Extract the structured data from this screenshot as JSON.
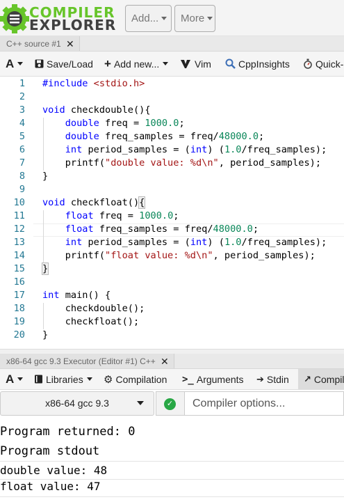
{
  "app": {
    "logo_top": "COMPILER",
    "logo_bottom": "EXPLORER",
    "add_menu": "Add...",
    "more_menu": "More"
  },
  "source_tab": {
    "title": "C++ source #1",
    "close": "✕"
  },
  "editor_toolbar": {
    "font_button": "A",
    "save_load": "Save/Load",
    "add_new": "Add new...",
    "vim": "Vim",
    "cppinsights": "CppInsights",
    "quickbench": "Quick-bench"
  },
  "editor": {
    "line_numbers": [
      "1",
      "2",
      "3",
      "4",
      "5",
      "6",
      "7",
      "8",
      "9",
      "10",
      "11",
      "12",
      "13",
      "14",
      "15",
      "16",
      "17",
      "18",
      "19",
      "20"
    ],
    "lines": [
      "#include <stdio.h>",
      "",
      "void checkdouble(){",
      "    double freq = 1000.0;",
      "    double freq_samples = freq/48000.0;",
      "    int period_samples = (int) (1.0/freq_samples);",
      "    printf(\"double value: %d\\n\", period_samples);",
      "}",
      "",
      "void checkfloat(){",
      "    float freq = 1000.0;",
      "    float freq_samples = freq/48000.0;",
      "    int period_samples = (int) (1.0/freq_samples);",
      "    printf(\"float value: %d\\n\", period_samples);",
      "}",
      "",
      "int main() {",
      "    checkdouble();",
      "    checkfloat();",
      "}"
    ]
  },
  "executor_tab": {
    "title": "x86-64 gcc 9.3 Executor (Editor #1) C++",
    "close": "✕"
  },
  "executor_toolbar": {
    "font_button": "A",
    "libraries": "Libraries",
    "compilation": "Compilation",
    "arguments": "Arguments",
    "stdin": "Stdin",
    "compiler_output": "Compiler output"
  },
  "compiler": {
    "selected": "x86-64 gcc 9.3",
    "options_placeholder": "Compiler options...",
    "status_color": "#28a745"
  },
  "output": {
    "returned": "Program returned: 0",
    "stdout_header": "Program stdout",
    "lines": [
      "double value: 48",
      "float value: 47"
    ]
  }
}
